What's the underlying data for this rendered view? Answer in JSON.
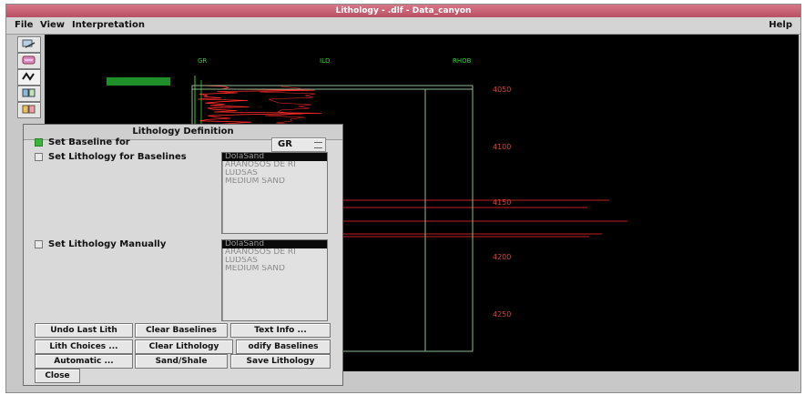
{
  "window": {
    "title": "Lithology - .dlf - Data_canyon",
    "menus": [
      "File",
      "View",
      "Interpretation"
    ],
    "help_label": "Help"
  },
  "toolbar": {
    "icons": [
      "interpret-icon",
      "layers-icon",
      "zigzag-icon",
      "grid-icon",
      "panel-icon"
    ]
  },
  "plot": {
    "track_headers": [
      "GR",
      "ILD",
      "RHOB"
    ],
    "depth_labels": [
      "4050",
      "4100",
      "4150",
      "4200",
      "4250"
    ],
    "colors": {
      "background": "#000000",
      "curve": "#ff2a2a",
      "baseline": "#2fd32f",
      "frame": "#8fb98f",
      "label": "#c94646"
    }
  },
  "dialog": {
    "title": "Lithology Definition",
    "set_baseline_label": "Set Baseline for",
    "baseline_value": "GR",
    "set_lithology_baselines_label": "Set Lithology for Baselines",
    "set_lithology_manually_label": "Set Lithology Manually",
    "lithology_list_1": [
      "DolaSand",
      "ARANOSOS DE RI",
      "LUDSAS",
      "MEDIUM SAND"
    ],
    "lithology_list_2": [
      "DolaSand",
      "ARANOSOS DE RI",
      "LUDSAS",
      "MEDIUM SAND"
    ],
    "buttons": {
      "undo_last_lith": "Undo Last Lith",
      "clear_baselines": "Clear Baselines",
      "text_info": "Text Info ...",
      "lith_choices": "Lith Choices ...",
      "clear_lithology": "Clear Lithology",
      "modify_baselines": "odify Baselines",
      "automatic": "Automatic ...",
      "sand_shale": "Sand/Shale",
      "save_lithology": "Save Lithology",
      "close": "Close"
    }
  }
}
